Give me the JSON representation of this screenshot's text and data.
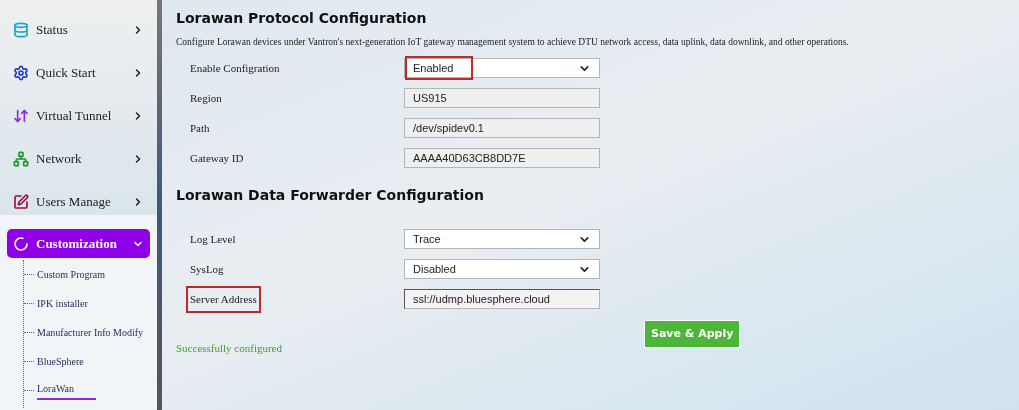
{
  "sidebar": {
    "items": [
      {
        "label": "Status",
        "expanded": false,
        "selected": false
      },
      {
        "label": "Quick Start",
        "expanded": false,
        "selected": false
      },
      {
        "label": "Virtual Tunnel",
        "expanded": false,
        "selected": false
      },
      {
        "label": "Network",
        "expanded": false,
        "selected": false
      },
      {
        "label": "Users Manage",
        "expanded": false,
        "selected": false
      },
      {
        "label": "Customization",
        "expanded": true,
        "selected": true,
        "children": [
          {
            "label": "Custom Program",
            "selected": false
          },
          {
            "label": "IPK installer",
            "selected": false
          },
          {
            "label": "Manufacturer Info Modify",
            "selected": false
          },
          {
            "label": "BlueSphere",
            "selected": false
          },
          {
            "label": "LoraWan",
            "selected": true
          }
        ]
      }
    ]
  },
  "sections": [
    {
      "title": "Lorawan Protocol Configuration",
      "description": "Configure Lorawan devices under Vantron's next-generation IoT gateway management system to achieve DTU network access, data uplink, data downlink, and other operations.",
      "fields": [
        {
          "label": "Enable Configration",
          "kind": "select",
          "value": "Enabled",
          "label_highlighted": false,
          "value_highlighted": true
        },
        {
          "label": "Region",
          "kind": "readonly",
          "value": "US915",
          "label_highlighted": false,
          "value_highlighted": false
        },
        {
          "label": "Path",
          "kind": "readonly",
          "value": "/dev/spidev0.1",
          "label_highlighted": false,
          "value_highlighted": false
        },
        {
          "label": "Gateway ID",
          "kind": "readonly",
          "value": "AAAA40D63CB8DD7E",
          "label_highlighted": false,
          "value_highlighted": false
        }
      ]
    },
    {
      "title": "Lorawan Data Forwarder Configuration",
      "fields": [
        {
          "label": "Log Level",
          "kind": "select",
          "value": "Trace",
          "label_highlighted": false,
          "value_highlighted": false
        },
        {
          "label": "SysLog",
          "kind": "select",
          "value": "Disabled",
          "label_highlighted": false,
          "value_highlighted": false
        },
        {
          "label": "Server Address",
          "kind": "input",
          "value": "ssl://udmp.bluesphere.cloud",
          "label_highlighted": true,
          "value_highlighted": false
        }
      ]
    }
  ],
  "save_button": "Save & Apply",
  "status_message": "Successfully configured"
}
